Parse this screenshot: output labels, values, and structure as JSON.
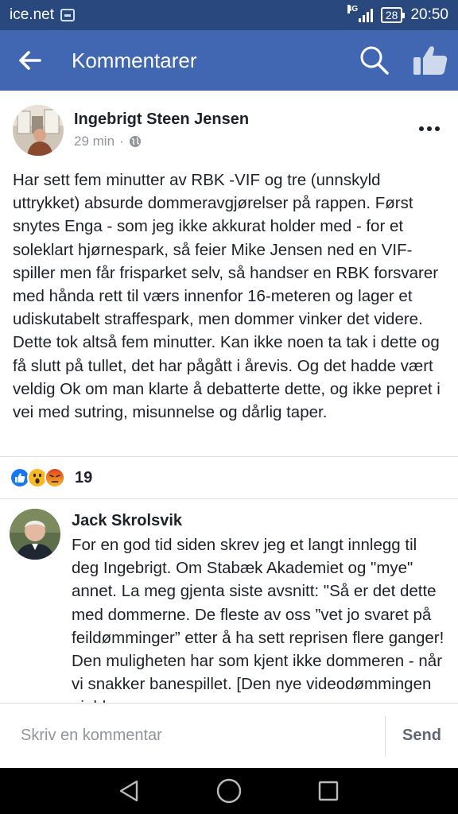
{
  "status_bar": {
    "carrier": "ice.net",
    "network": "4G",
    "battery": "28",
    "time": "20:50"
  },
  "app_bar": {
    "title": "Kommentarer",
    "back_icon": "arrow-back-icon",
    "search_icon": "search-icon",
    "like_icon": "thumbs-up-icon",
    "bg_color": "#4267b2"
  },
  "post": {
    "author": "Ingebrigt Steen Jensen",
    "time": "29 min",
    "separator": "·",
    "privacy_icon": "globe-icon",
    "body": "Har sett fem minutter av RBK -VIF og tre (unnskyld uttrykket) absurde dommeravgjørelser på rappen. Først snytes Enga - som jeg ikke akkurat holder med - for et soleklart hjørnespark, så feier Mike Jensen ned en VIF-spiller men får frisparket selv, så handser en RBK forsvarer med hånda rett til værs innenfor 16-meteren og lager et udiskutabelt straffespark, men dommer vinker det videre. Dette tok altså fem minutter. Kan ikke noen ta tak i dette og få slutt på tullet, det har pågått i årevis. Og det hadde vært veldig Ok om man klarte å debatterte dette, og ikke pepret i vei med sutring, misunnelse og dårlig taper."
  },
  "reactions": {
    "types": [
      "like",
      "wow",
      "angry"
    ],
    "count": "19"
  },
  "comment": {
    "author": "Jack Skrolsvik",
    "text": "For en god tid siden skrev jeg et langt innlegg til deg Ingebrigt. Om Stabæk Akademiet og \"mye\" annet. La meg gjenta siste avsnitt: \"Så er det dette med dommerne. De fleste av oss ”vet jo svaret på feildømminger” etter å ha sett reprisen flere ganger! Den muligheten har som kjent ikke dommeren - når vi snakker banespillet. [Den nye videodømmingen gjelder"
  },
  "composer": {
    "placeholder": "Skriv en kommentar",
    "send_label": "Send"
  }
}
